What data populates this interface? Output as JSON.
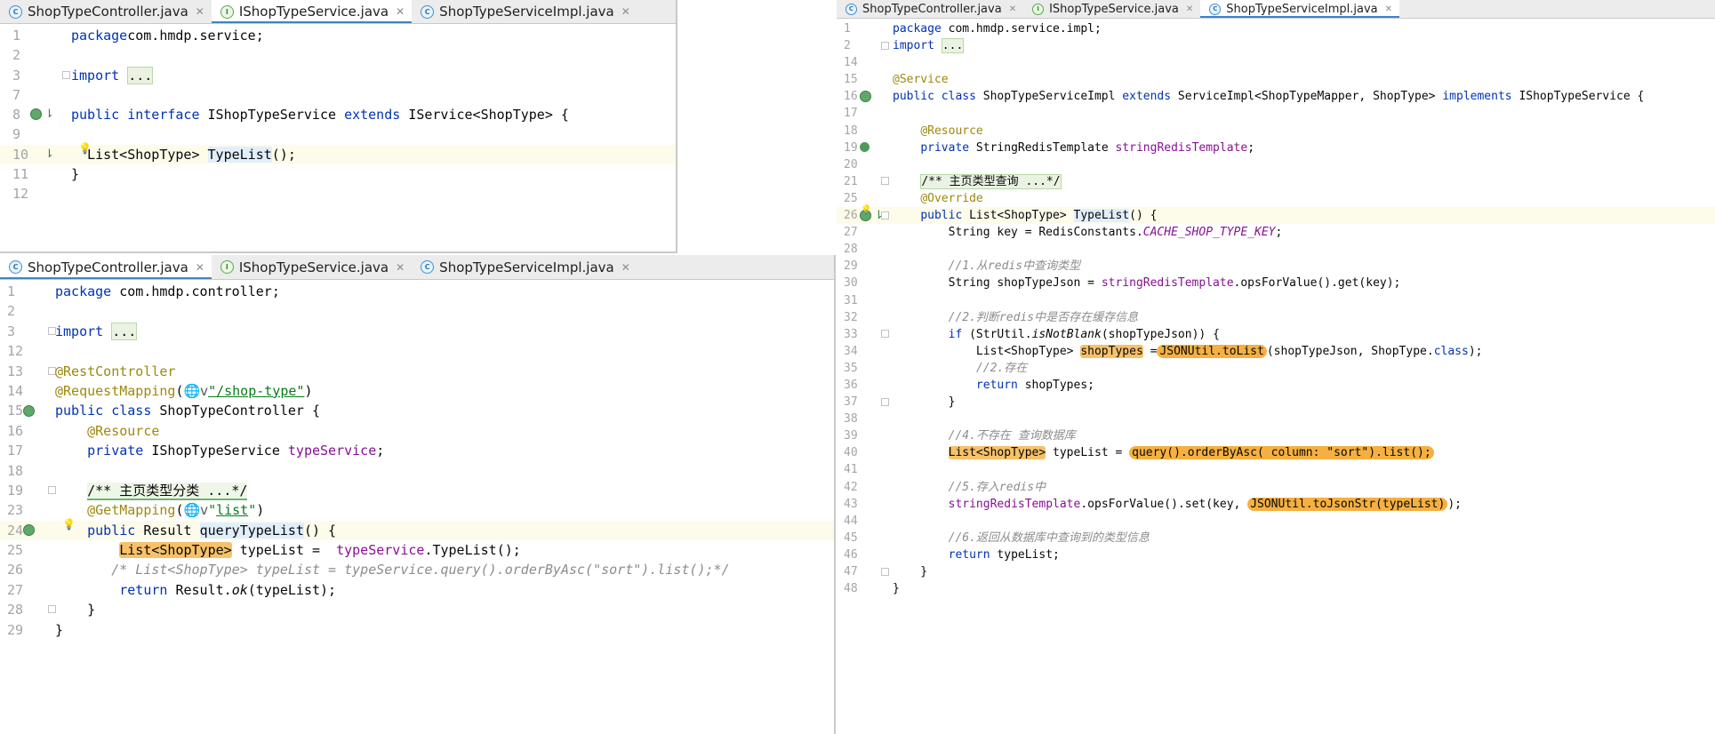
{
  "panes": {
    "top_left": {
      "tabs": [
        {
          "label": "ShopTypeController.java",
          "kind": "c",
          "active": false
        },
        {
          "label": "IShopTypeService.java",
          "kind": "i",
          "active": true
        },
        {
          "label": "ShopTypeServiceImpl.java",
          "kind": "c",
          "active": false
        }
      ],
      "lines": [
        {
          "n": "1",
          "code": [
            [
              "kw",
              "package"
            ],
            [
              "",
              "com.hmdp.service;"
            ]
          ]
        },
        {
          "n": "2",
          "code": []
        },
        {
          "n": "3",
          "code": [
            [
              "kw",
              "import"
            ],
            [
              "",
              " "
            ],
            [
              "hlg",
              "..."
            ]
          ]
        },
        {
          "n": "7",
          "code": []
        },
        {
          "n": "8",
          "code": [
            [
              "kw",
              "public interface"
            ],
            [
              "",
              " IShopTypeService "
            ],
            [
              "kw",
              "extends"
            ],
            [
              "",
              " IService<ShopType> {"
            ]
          ]
        },
        {
          "n": "9",
          "code": []
        },
        {
          "n": "10",
          "code": [
            [
              "",
              "  List<ShopType> "
            ],
            [
              "hl",
              "TypeList"
            ],
            [
              "",
              "();"
            ]
          ]
        },
        {
          "n": "11",
          "code": [
            [
              "",
              "}"
            ]
          ]
        },
        {
          "n": "12",
          "code": []
        }
      ]
    },
    "bottom_left": {
      "tabs": [
        {
          "label": "ShopTypeController.java",
          "kind": "c",
          "active": true
        },
        {
          "label": "IShopTypeService.java",
          "kind": "i",
          "active": false
        },
        {
          "label": "ShopTypeServiceImpl.java",
          "kind": "c",
          "active": false
        }
      ],
      "lines": [
        {
          "n": "1",
          "code": [
            [
              "kw",
              "package"
            ],
            [
              "",
              " com.hmdp.controller;"
            ]
          ]
        },
        {
          "n": "2",
          "code": []
        },
        {
          "n": "3",
          "code": [
            [
              "kw",
              "import"
            ],
            [
              "",
              " "
            ],
            [
              "hlg",
              "..."
            ]
          ]
        },
        {
          "n": "12",
          "code": []
        },
        {
          "n": "13",
          "code": [
            [
              "an",
              "@RestController"
            ]
          ]
        },
        {
          "n": "14",
          "code": [
            [
              "an",
              "@RequestMapping"
            ],
            [
              "",
              "("
            ],
            [
              "globe",
              "🌐v"
            ],
            [
              "st ul",
              "\"/shop-type\""
            ],
            [
              "",
              ")"
            ]
          ]
        },
        {
          "n": "15",
          "code": [
            [
              "kw",
              "public class"
            ],
            [
              "",
              " ShopTypeController {"
            ]
          ]
        },
        {
          "n": "16",
          "code": [
            [
              "",
              "    "
            ],
            [
              "an",
              "@Resource"
            ]
          ]
        },
        {
          "n": "17",
          "code": [
            [
              "",
              "    "
            ],
            [
              "kw",
              "private"
            ],
            [
              "",
              " IShopTypeService "
            ],
            [
              "fd",
              "typeService"
            ],
            [
              "",
              ";"
            ]
          ]
        },
        {
          "n": "18",
          "code": []
        },
        {
          "n": "19",
          "code": [
            [
              "",
              "    "
            ],
            [
              "hlgb",
              "/** 主页类型分类 ...*/"
            ]
          ]
        },
        {
          "n": "23",
          "code": [
            [
              "",
              "    "
            ],
            [
              "an",
              "@GetMapping"
            ],
            [
              "",
              "("
            ],
            [
              "globe",
              "🌐v"
            ],
            [
              "st",
              "\""
            ],
            [
              "st ul",
              "list"
            ],
            [
              "st",
              "\""
            ],
            [
              "",
              ")"
            ]
          ]
        },
        {
          "n": "24",
          "code": [
            [
              "",
              "    "
            ],
            [
              "kw",
              "public"
            ],
            [
              "",
              " Result "
            ],
            [
              "hl",
              "queryTypeList"
            ],
            [
              "",
              "() {"
            ]
          ]
        },
        {
          "n": "25",
          "code": [
            [
              "",
              "        "
            ],
            [
              "hlo",
              "List<ShopType>"
            ],
            [
              "",
              " typeList =  "
            ],
            [
              "fd",
              "typeService"
            ],
            [
              "",
              ".TypeList();"
            ]
          ]
        },
        {
          "n": "26",
          "code": [
            [
              "",
              "       "
            ],
            [
              "cm",
              "/* List<ShopType> typeList = typeService.query().orderByAsc(\"sort\").list();*/"
            ]
          ]
        },
        {
          "n": "27",
          "code": [
            [
              "",
              "        "
            ],
            [
              "kw",
              "return"
            ],
            [
              "",
              " Result."
            ],
            [
              "it",
              "ok"
            ],
            [
              "",
              "(typeList);"
            ]
          ]
        },
        {
          "n": "28",
          "code": [
            [
              "",
              "    }"
            ]
          ]
        },
        {
          "n": "29",
          "code": [
            [
              "",
              "}"
            ]
          ]
        }
      ]
    },
    "right": {
      "tabs": [
        {
          "label": "ShopTypeController.java",
          "kind": "c",
          "active": false
        },
        {
          "label": "IShopTypeService.java",
          "kind": "i",
          "active": false
        },
        {
          "label": "ShopTypeServiceImpl.java",
          "kind": "c",
          "active": true
        }
      ],
      "lines": [
        {
          "n": "1",
          "code": [
            [
              "kw",
              "package"
            ],
            [
              "",
              " com.hmdp.service.impl;"
            ]
          ]
        },
        {
          "n": "2",
          "code": [
            [
              "kw",
              "import"
            ],
            [
              "",
              " "
            ],
            [
              "hlg",
              "..."
            ]
          ]
        },
        {
          "n": "14",
          "code": []
        },
        {
          "n": "15",
          "code": [
            [
              "an",
              "@Service"
            ]
          ]
        },
        {
          "n": "16",
          "code": [
            [
              "kw",
              "public class"
            ],
            [
              "",
              " ShopTypeServiceImpl "
            ],
            [
              "kw",
              "extends"
            ],
            [
              "",
              " ServiceImpl<ShopTypeMapper, ShopType> "
            ],
            [
              "kw",
              "implements"
            ],
            [
              "",
              " IShopTypeService {"
            ]
          ]
        },
        {
          "n": "17",
          "code": []
        },
        {
          "n": "18",
          "code": [
            [
              "",
              "    "
            ],
            [
              "an",
              "@Resource"
            ]
          ]
        },
        {
          "n": "19",
          "code": [
            [
              "",
              "    "
            ],
            [
              "kw",
              "private"
            ],
            [
              "",
              " StringRedisTemplate "
            ],
            [
              "fd",
              "stringRedisTemplate"
            ],
            [
              "",
              ";"
            ]
          ]
        },
        {
          "n": "20",
          "code": []
        },
        {
          "n": "21",
          "code": [
            [
              "",
              "    "
            ],
            [
              "hlg",
              "/** 主页类型查询 ...*/"
            ]
          ]
        },
        {
          "n": "25",
          "code": [
            [
              "",
              "    "
            ],
            [
              "an",
              "@Override"
            ]
          ]
        },
        {
          "n": "26",
          "code": [
            [
              "",
              "    "
            ],
            [
              "kw",
              "public"
            ],
            [
              "",
              " List<ShopType> "
            ],
            [
              "hl",
              "TypeList"
            ],
            [
              "",
              "() {"
            ]
          ]
        },
        {
          "n": "27",
          "code": [
            [
              "",
              "        String key = RedisConstants."
            ],
            [
              "cnst",
              "CACHE_SHOP_TYPE_KEY"
            ],
            [
              "",
              ";"
            ]
          ]
        },
        {
          "n": "28",
          "code": []
        },
        {
          "n": "29",
          "code": [
            [
              "",
              "        "
            ],
            [
              "cm",
              "//1.从redis中查询类型"
            ]
          ]
        },
        {
          "n": "30",
          "code": [
            [
              "",
              "        String shopTypeJson = "
            ],
            [
              "fd",
              "stringRedisTemplate"
            ],
            [
              "",
              ".opsForValue().get(key);"
            ]
          ]
        },
        {
          "n": "31",
          "code": []
        },
        {
          "n": "32",
          "code": [
            [
              "",
              "        "
            ],
            [
              "cm",
              "//2.判断redis中是否存在缓存信息"
            ]
          ]
        },
        {
          "n": "33",
          "code": [
            [
              "",
              "        "
            ],
            [
              "kw",
              "if"
            ],
            [
              "",
              " (StrUtil."
            ],
            [
              "it",
              "isNotBlank"
            ],
            [
              "",
              "(shopTypeJson)) {"
            ]
          ]
        },
        {
          "n": "34",
          "code": [
            [
              "",
              "            List<ShopType> "
            ],
            [
              "hlo",
              "shopTypes"
            ],
            [
              "",
              " ="
            ],
            [
              "hlorange",
              "JSONUtil.toList"
            ],
            [
              "",
              "(shopTypeJson, ShopType."
            ],
            [
              "kw",
              "class"
            ],
            [
              "",
              ");"
            ]
          ]
        },
        {
          "n": "35",
          "code": [
            [
              "",
              "            "
            ],
            [
              "cm",
              "//2.存在"
            ]
          ]
        },
        {
          "n": "36",
          "code": [
            [
              "",
              "            "
            ],
            [
              "kw",
              "return"
            ],
            [
              "",
              " shopTypes;"
            ]
          ]
        },
        {
          "n": "37",
          "code": [
            [
              "",
              "        }"
            ]
          ]
        },
        {
          "n": "38",
          "code": []
        },
        {
          "n": "39",
          "code": [
            [
              "",
              "        "
            ],
            [
              "cm",
              "//4.不存在 查询数据库"
            ]
          ]
        },
        {
          "n": "40",
          "code": [
            [
              "",
              "        "
            ],
            [
              "hlo",
              "List<ShopType>"
            ],
            [
              "",
              " typeList = "
            ],
            [
              "hlorange",
              "query().orderByAsc( column: \"sort\").list();"
            ]
          ]
        },
        {
          "n": "41",
          "code": []
        },
        {
          "n": "42",
          "code": [
            [
              "",
              "        "
            ],
            [
              "cm",
              "//5.存入redis中"
            ]
          ]
        },
        {
          "n": "43",
          "code": [
            [
              "",
              "        "
            ],
            [
              "fd",
              "stringRedisTemplate"
            ],
            [
              "",
              ".opsForValue().set(key, "
            ],
            [
              "hlorange",
              "JSONUtil.toJsonStr(typeList)"
            ],
            [
              "",
              ");"
            ]
          ]
        },
        {
          "n": "44",
          "code": []
        },
        {
          "n": "45",
          "code": [
            [
              "",
              "        "
            ],
            [
              "cm",
              "//6.返回从数据库中查询到的类型信息"
            ]
          ]
        },
        {
          "n": "46",
          "code": [
            [
              "",
              "        "
            ],
            [
              "kw",
              "return"
            ],
            [
              "",
              " typeList;"
            ]
          ]
        },
        {
          "n": "47",
          "code": [
            [
              "",
              "    }"
            ]
          ]
        },
        {
          "n": "48",
          "code": [
            [
              "",
              "}"
            ]
          ]
        }
      ]
    }
  },
  "icons": {
    "class_file": "C",
    "interface_file": "I",
    "close": "✕",
    "bulb": "💡",
    "gutter_arrow": "⇂"
  }
}
